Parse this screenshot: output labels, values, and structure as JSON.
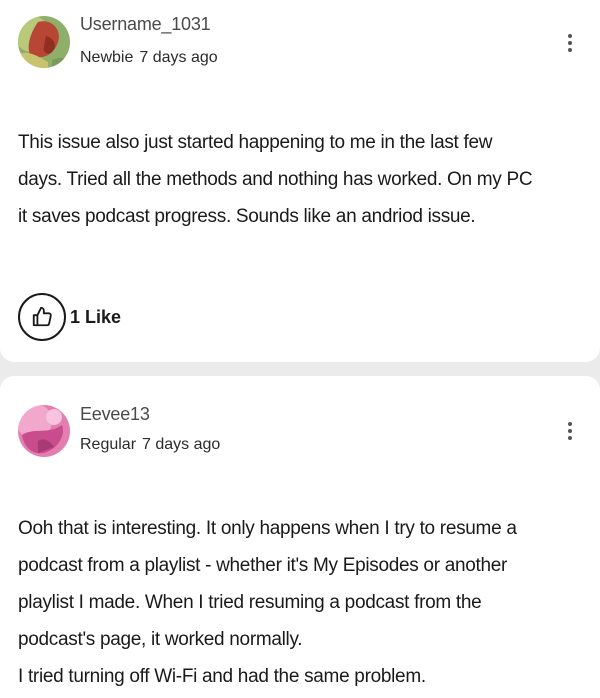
{
  "posts": [
    {
      "username": "Username_1031",
      "rank": "Newbie",
      "time": "7 days ago",
      "avatar_icon": "user-avatar-icon",
      "body": [
        "This issue also just started happening to me in the last few",
        "days. Tried all the methods and nothing has worked. On my PC",
        "it saves podcast progress. Sounds like an andriod issue."
      ],
      "like_icon": "thumbs-up-icon",
      "likes_label": "1 Like"
    },
    {
      "username": "Eevee13",
      "rank": "Regular",
      "time": "7 days ago",
      "avatar_icon": "user-avatar-icon",
      "body": [
        "Ooh that is interesting. It only happens when I try to resume a",
        "podcast from a playlist - whether it's My Episodes or another",
        "playlist I made. When I tried resuming a podcast from the",
        "podcast's page, it worked normally.",
        "I tried turning off Wi-Fi and had the same problem."
      ]
    }
  ],
  "menu_icon": "more-vertical-icon",
  "colors": {
    "background": "#ebebeb",
    "card": "#ffffff",
    "text": "#1a1a1a",
    "muted": "#4a4a4a"
  }
}
